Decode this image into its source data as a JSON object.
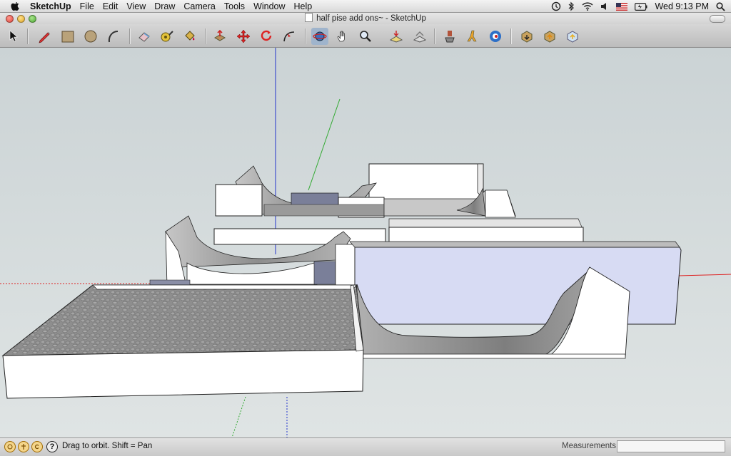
{
  "menubar": {
    "app_name": "SketchUp",
    "items": [
      "File",
      "Edit",
      "View",
      "Draw",
      "Camera",
      "Tools",
      "Window",
      "Help"
    ],
    "clock": "Wed 9:13 PM"
  },
  "window": {
    "title": "half pise add ons~ - SketchUp"
  },
  "toolbar": {
    "tools": [
      "select-tool-icon",
      "pencil-tool-icon",
      "rectangle-tool-icon",
      "circle-tool-icon",
      "arc-tool-icon",
      "eraser-tool-icon",
      "tape-measure-icon",
      "paint-bucket-icon",
      "push-pull-icon",
      "move-tool-icon",
      "rotate-tool-icon",
      "follow-me-icon",
      "orbit-tool-icon",
      "pan-tool-icon",
      "zoom-tool-icon",
      "zoom-extents-icon",
      "previous-view-icon",
      "position-camera-icon",
      "walk-tool-icon",
      "look-around-icon",
      "get-models-icon",
      "share-model-icon",
      "share-component-icon"
    ]
  },
  "statusbar": {
    "hint": "Drag to orbit.  Shift = Pan",
    "measurements_label": "Measurements",
    "measurements_value": ""
  },
  "colors": {
    "viewport_bg": "#d4dadb",
    "face_front": "#ffffff",
    "face_back_side": "#d7dbf3",
    "ramp_shade": "#9a9a9a",
    "axis_blue": "#2233cc",
    "axis_green": "#33aa33",
    "axis_red": "#dd2222"
  }
}
